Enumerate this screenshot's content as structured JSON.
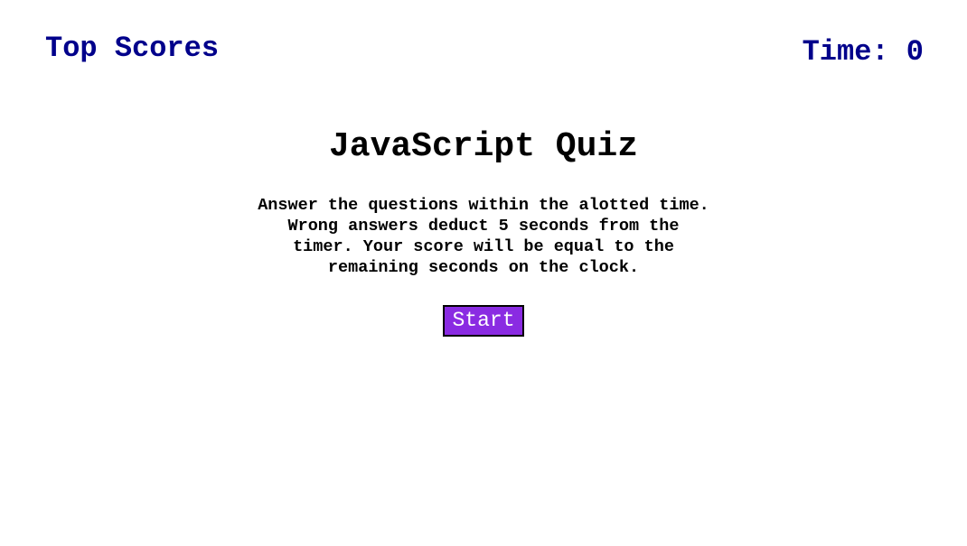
{
  "header": {
    "top_scores_label": "Top Scores",
    "timer_prefix": "Time: ",
    "timer_value": "0"
  },
  "main": {
    "title": "JavaScript Quiz",
    "instructions": "Answer the questions within the alotted time. Wrong answers deduct 5 seconds from the timer. Your score will be equal to the remaining seconds on the clock.",
    "start_label": "Start"
  },
  "colors": {
    "header_text": "#00008b",
    "start_button_bg": "#8a2be2",
    "start_button_text": "#ffffff"
  }
}
